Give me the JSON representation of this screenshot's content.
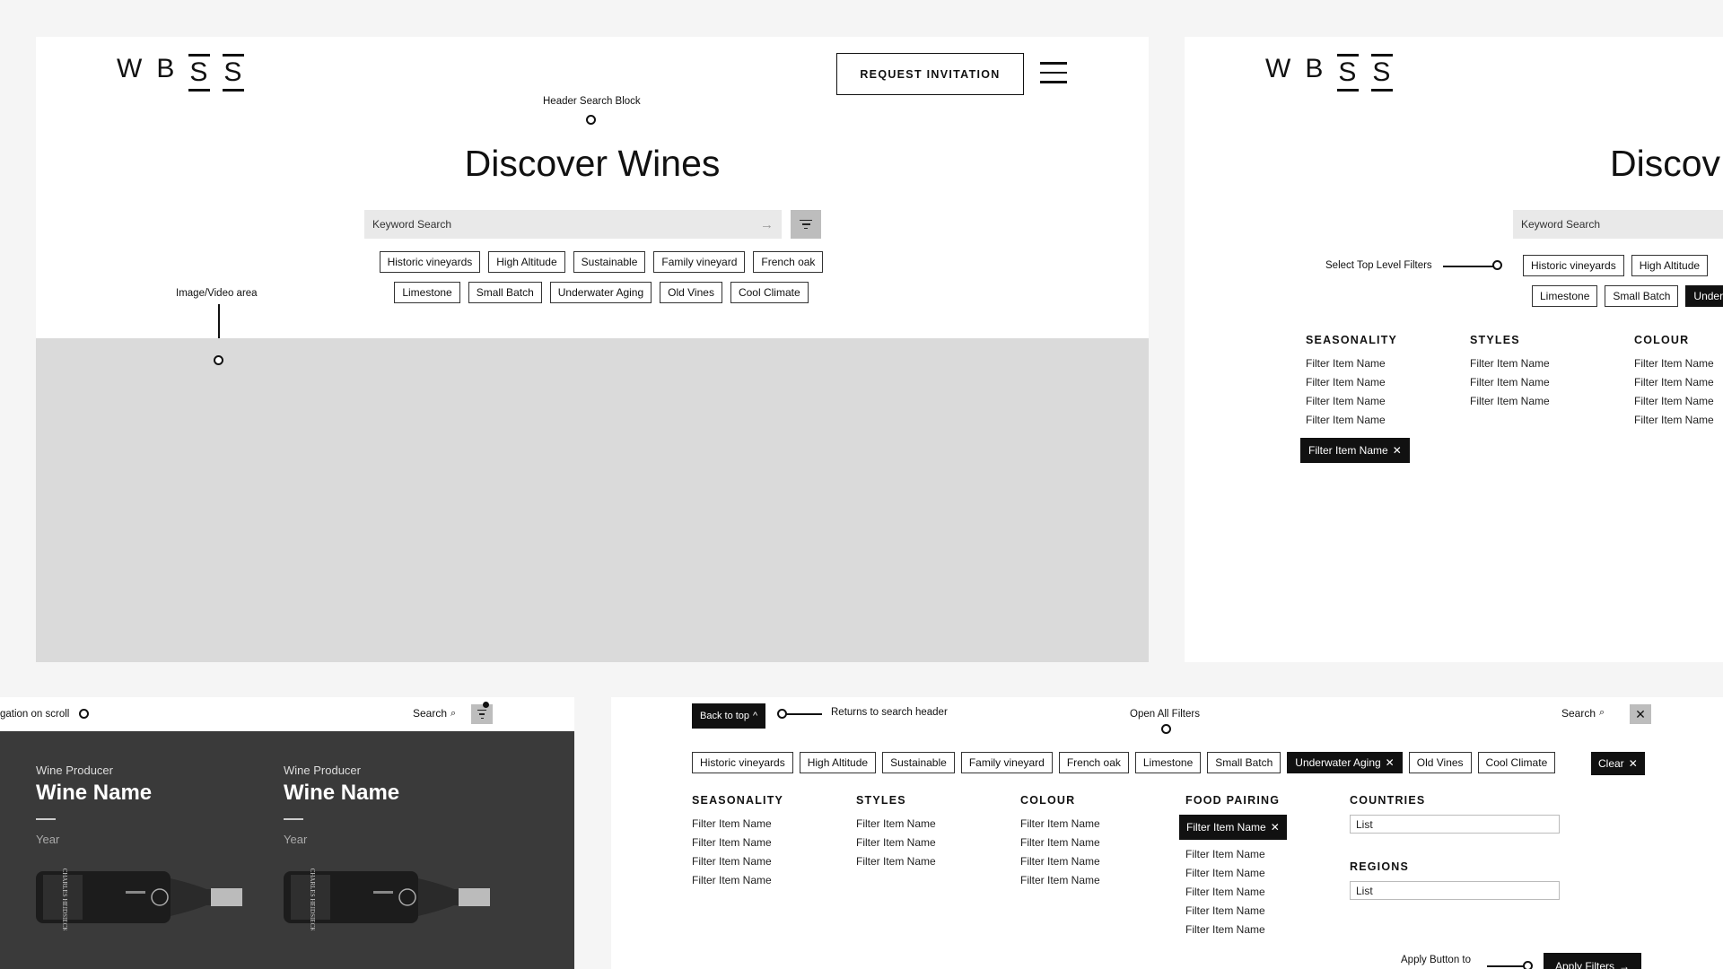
{
  "logo": "WBSS",
  "board1": {
    "request_invitation": "REQUEST INVITATION",
    "note_header_search": "Header Search Block",
    "title": "Discover Wines",
    "search_placeholder": "Keyword Search",
    "note_image_area": "Image/Video area",
    "tags_row1": [
      "Historic vineyards",
      "High Altitude",
      "Sustainable",
      "Family vineyard",
      "French oak"
    ],
    "tags_row2": [
      "Limestone",
      "Small Batch",
      "Underwater Aging",
      "Old Vines",
      "Cool Climate"
    ]
  },
  "board2": {
    "title": "Discov",
    "search_placeholder": "Keyword Search",
    "note_top_filters": "Select Top Level Filters",
    "tags_row1": [
      "Historic vineyards",
      "High Altitude"
    ],
    "tags_row2": [
      "Limestone",
      "Small Batch",
      "Underv"
    ],
    "columns": [
      {
        "heading": "SEASONALITY",
        "items": [
          "Filter Item Name",
          "Filter Item Name",
          "Filter Item Name",
          "Filter Item Name"
        ]
      },
      {
        "heading": "STYLES",
        "items": [
          "Filter Item Name",
          "Filter Item Name",
          "Filter Item Name"
        ]
      },
      {
        "heading": "COLOUR",
        "items": [
          "Filter Item Name",
          "Filter Item Name",
          "Filter Item Name",
          "Filter Item Name"
        ]
      }
    ],
    "selected_chip": "Filter Item Name"
  },
  "board3": {
    "note_nav_scroll": "gation on scroll",
    "search_label": "Search",
    "wines": [
      {
        "producer": "Wine Producer",
        "name": "Wine Name",
        "year": "Year"
      },
      {
        "producer": "Wine Producer",
        "name": "Wine Name",
        "year": "Year"
      }
    ],
    "bottle_label_text": "CHARLES HEIDSIECK"
  },
  "board4": {
    "back_to_top": "Back to top",
    "note_returns": "Returns to search header",
    "note_open_filters": "Open All Filters",
    "search_label": "Search",
    "tags": [
      "Historic vineyards",
      "High Altitude",
      "Sustainable",
      "Family vineyard",
      "French oak",
      "Limestone",
      "Small Batch",
      "Underwater Aging",
      "Old Vines",
      "Cool Climate"
    ],
    "clear_label": "Clear",
    "columns": [
      {
        "heading": "SEASONALITY",
        "items": [
          "Filter Item Name",
          "Filter Item Name",
          "Filter Item Name",
          "Filter Item Name"
        ]
      },
      {
        "heading": "STYLES",
        "items": [
          "Filter Item Name",
          "Filter Item Name",
          "Filter Item Name"
        ]
      },
      {
        "heading": "COLOUR",
        "items": [
          "Filter Item Name",
          "Filter Item Name",
          "Filter Item Name",
          "Filter Item Name"
        ]
      }
    ],
    "food_pairing": {
      "heading": "FOOD PAIRING",
      "selected": "Filter Item Name",
      "items": [
        "Filter Item Name",
        "Filter Item Name",
        "Filter Item Name",
        "Filter Item Name",
        "Filter Item Name"
      ]
    },
    "countries": {
      "heading": "COUNTRIES",
      "value": "List"
    },
    "regions": {
      "heading": "REGIONS",
      "value": "List"
    },
    "note_apply": "Apply Button to",
    "apply_label": "Apply Filters"
  },
  "colors": {
    "dark_panel": "#3a3a3a",
    "image_area": "#dadada",
    "search_bg": "#e9e9e9",
    "black": "#111111"
  }
}
